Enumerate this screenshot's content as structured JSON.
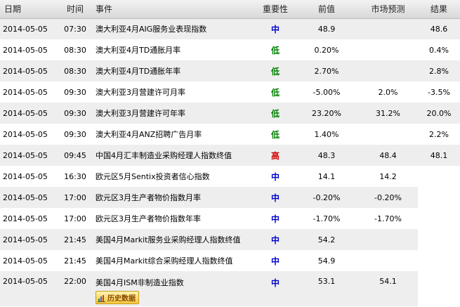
{
  "header": {
    "date": "日期",
    "time": "时间",
    "event": "事件",
    "importance": "重要性",
    "previous": "前值",
    "forecast": "市场预测",
    "result": "结果"
  },
  "colors": {
    "importance_medium": "#0000cc",
    "importance_low": "#008000",
    "importance_high": "#cc0000"
  },
  "rows": [
    {
      "date": "2014-05-05",
      "time": "07:30",
      "event": "澳大利亚4月AIG服务业表现指数",
      "importance": "中",
      "level": "medium",
      "previous": "48.9",
      "forecast": "",
      "result": "48.6"
    },
    {
      "date": "2014-05-05",
      "time": "08:30",
      "event": "澳大利亚4月TD通胀月率",
      "importance": "低",
      "level": "low",
      "previous": "0.20%",
      "forecast": "",
      "result": "0.4%"
    },
    {
      "date": "2014-05-05",
      "time": "08:30",
      "event": "澳大利亚4月TD通胀年率",
      "importance": "低",
      "level": "low",
      "previous": "2.70%",
      "forecast": "",
      "result": "2.8%"
    },
    {
      "date": "2014-05-05",
      "time": "09:30",
      "event": "澳大利亚3月营建许可月率",
      "importance": "低",
      "level": "low",
      "previous": "-5.00%",
      "forecast": "2.0%",
      "result": "-3.5%"
    },
    {
      "date": "2014-05-05",
      "time": "09:30",
      "event": "澳大利亚3月营建许可年率",
      "importance": "低",
      "level": "low",
      "previous": "23.20%",
      "forecast": "31.2%",
      "result": "20.0%"
    },
    {
      "date": "2014-05-05",
      "time": "09:30",
      "event": "澳大利亚4月ANZ招聘广告月率",
      "importance": "低",
      "level": "low",
      "previous": "1.40%",
      "forecast": "",
      "result": "2.2%"
    },
    {
      "date": "2014-05-05",
      "time": "09:45",
      "event": "中国4月汇丰制造业采购经理人指数终值",
      "importance": "高",
      "level": "high",
      "previous": "48.3",
      "forecast": "48.4",
      "result": "48.1"
    },
    {
      "date": "2014-05-05",
      "time": "16:30",
      "event": "欧元区5月Sentix投资者信心指数",
      "importance": "中",
      "level": "medium",
      "previous": "14.1",
      "forecast": "14.2",
      "result": ""
    },
    {
      "date": "2014-05-05",
      "time": "17:00",
      "event": "欧元区3月生产者物价指数月率",
      "importance": "中",
      "level": "medium",
      "previous": "-0.20%",
      "forecast": "-0.20%",
      "result": ""
    },
    {
      "date": "2014-05-05",
      "time": "17:00",
      "event": "欧元区3月生产者物价指数年率",
      "importance": "中",
      "level": "medium",
      "previous": "-1.70%",
      "forecast": "-1.70%",
      "result": ""
    },
    {
      "date": "2014-05-05",
      "time": "21:45",
      "event": "美国4月Markit服务业采购经理人指数终值",
      "importance": "中",
      "level": "medium",
      "previous": "54.2",
      "forecast": "",
      "result": ""
    },
    {
      "date": "2014-05-05",
      "time": "21:45",
      "event": "美国4月Markit综合采购经理人指数终值",
      "importance": "中",
      "level": "medium",
      "previous": "54.9",
      "forecast": "",
      "result": ""
    },
    {
      "date": "2014-05-05",
      "time": "22:00",
      "event": "美国4月ISM非制造业指数",
      "importance": "中",
      "level": "medium",
      "previous": "53.1",
      "forecast": "54.1",
      "result": ""
    }
  ],
  "history_button": {
    "label": "历史数据",
    "icon": "bar-chart-icon"
  }
}
